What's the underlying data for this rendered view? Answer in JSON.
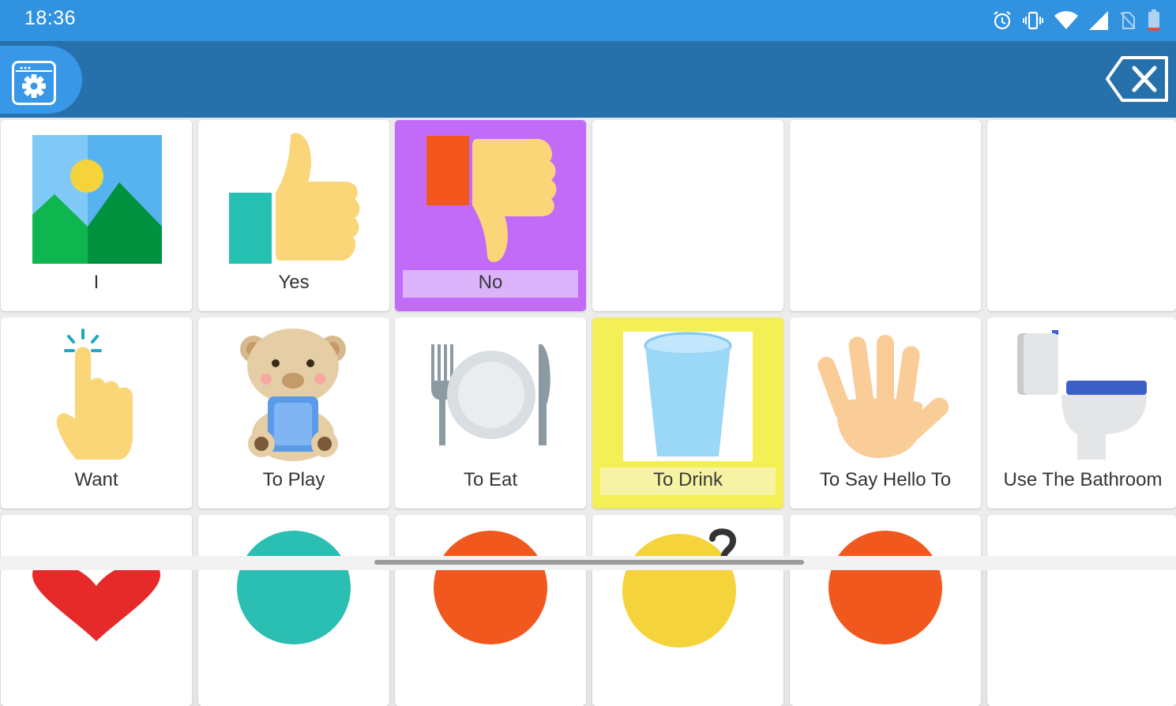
{
  "status_bar": {
    "time": "18:36",
    "icons": [
      "alarm-icon",
      "vibrate-icon",
      "wifi-icon",
      "cell-signal-icon",
      "no-sim-icon",
      "battery-icon"
    ]
  },
  "toolbar": {
    "settings_icon": "gear-icon",
    "backspace_icon": "backspace-icon"
  },
  "grid": {
    "rows": [
      [
        {
          "label": "I",
          "icon": "picture-icon"
        },
        {
          "label": "Yes",
          "icon": "thumbs-up-icon"
        },
        {
          "label": "No",
          "icon": "thumbs-down-icon",
          "highlight": "#c26bf9"
        },
        {
          "label": "",
          "icon": ""
        },
        {
          "label": "",
          "icon": ""
        },
        {
          "label": "",
          "icon": ""
        }
      ],
      [
        {
          "label": "Want",
          "icon": "pointing-finger-icon"
        },
        {
          "label": "To Play",
          "icon": "teddy-bear-icon"
        },
        {
          "label": "To Eat",
          "icon": "plate-cutlery-icon"
        },
        {
          "label": "To Drink",
          "icon": "glass-of-water-icon",
          "highlight": "#f3ef55"
        },
        {
          "label": "To Say Hello To",
          "icon": "waving-hand-icon"
        },
        {
          "label": "Use The Bathroom",
          "icon": "toilet-icon"
        }
      ],
      [
        {
          "label": "",
          "icon": "heart-icon"
        },
        {
          "label": "",
          "icon": "teal-circle-icon"
        },
        {
          "label": "",
          "icon": "orange-circle-icon"
        },
        {
          "label": "",
          "icon": "question-face-icon"
        },
        {
          "label": "",
          "icon": "orange-circle-icon"
        },
        {
          "label": "",
          "icon": ""
        }
      ]
    ]
  }
}
